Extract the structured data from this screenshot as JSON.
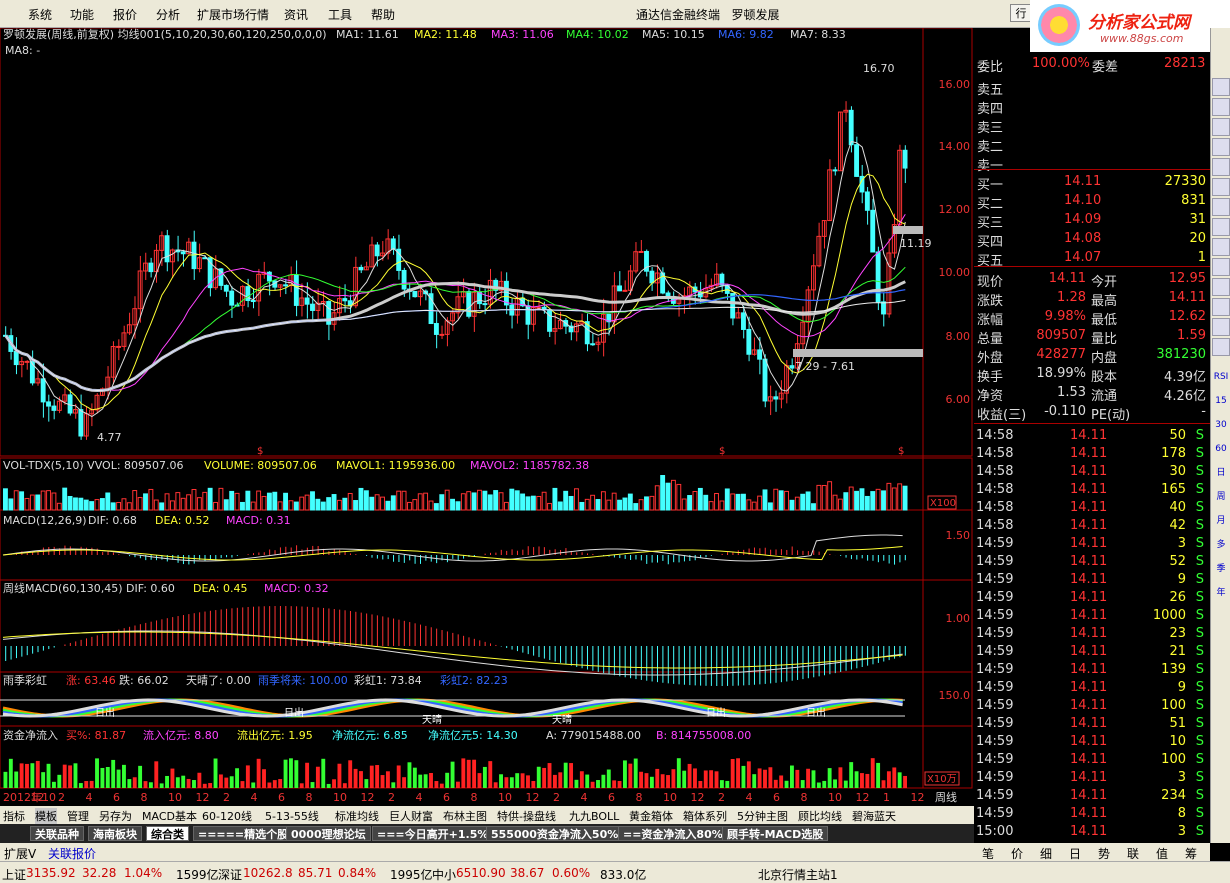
{
  "menu": {
    "items": [
      "系统",
      "功能",
      "报价",
      "分析",
      "扩展市场行情",
      "资讯",
      "工具",
      "帮助"
    ],
    "center_title": "通达信金融终端",
    "stock_title": "罗顿发展",
    "right_btn": "行"
  },
  "logo": {
    "name": "分析家公式网",
    "url": "www.88gs.com"
  },
  "main_chart": {
    "header": "罗顿发展(周线,前复权) 均线001(5,10,20,30,60,120,250,0,0,0)",
    "ma_labels": [
      "MA1: 11.61",
      "MA2: 11.48",
      "MA3: 11.06",
      "MA4: 10.02",
      "MA5: 10.15",
      "MA6: 9.82",
      "MA7: 8.33",
      "MA8: -"
    ],
    "y_ticks": [
      "16.00",
      "14.00",
      "12.00",
      "10.00",
      "8.00",
      "6.00"
    ],
    "annotations": {
      "high": "16.70",
      "low": "4.77",
      "range": "7.29 - 7.61",
      "mid": "11.19"
    }
  },
  "chart_data": {
    "type": "candlestick",
    "title": "罗顿发展(周线,前复权)",
    "y_range": [
      5.5,
      17.2
    ],
    "high": 16.7,
    "low": 4.77,
    "last": 14.11
  },
  "vol_panel": {
    "header": "VOL-TDX(5,10) VVOL: 809507.06",
    "items": [
      "VOLUME: 809507.06",
      "MAVOL1: 1195936.00",
      "MAVOL2: 1185782.38"
    ],
    "scale": "X100"
  },
  "macd_panel": {
    "header": "MACD(12,26,9)",
    "items": [
      "DIF: 0.68",
      "DEA: 0.52",
      "MACD: 0.31"
    ],
    "tick": "1.50"
  },
  "wmacd_panel": {
    "header": "周线MACD(60,130,45)",
    "items": [
      "DIF: 0.60",
      "DEA: 0.45",
      "MACD: 0.32"
    ],
    "tick": "1.00"
  },
  "rainbow_panel": {
    "header": "雨季彩虹",
    "items": [
      "涨: 63.46",
      "跌: 66.02",
      "天晴了: 0.00",
      "雨季将来: 100.00",
      "彩虹1: 73.84",
      "彩虹2: 82.23"
    ],
    "tick": "150.0",
    "labels": [
      "日出",
      "日出",
      "日出",
      "日出",
      "天晴",
      "天晴"
    ]
  },
  "flow_panel": {
    "header": "资金净流入",
    "items": [
      "买%: 81.87",
      "流入亿元: 8.80",
      "流出亿元: 1.95",
      "净流亿元: 6.85",
      "净流亿元5: 14.30",
      "A: 779015488.00",
      "B: 814755008.00"
    ],
    "scale": "X10万"
  },
  "x_axis": {
    "labels": [
      "2012年10",
      "12",
      "2",
      "4",
      "6",
      "8",
      "10",
      "12",
      "2",
      "4",
      "6",
      "8",
      "10",
      "12",
      "2",
      "4",
      "6",
      "8",
      "10",
      "12",
      "2",
      "4",
      "6",
      "8",
      "10",
      "12",
      "2",
      "4",
      "6",
      "8",
      "10",
      "12",
      "1",
      "12"
    ],
    "period": "周线"
  },
  "tabs_row1": [
    "指标",
    "模板",
    "管理",
    "另存为",
    "MACD基本",
    "60-120线",
    "5-13-55线",
    "标准均线",
    "巨人财富",
    "布林主图",
    "特供-操盘线",
    "九九BOLL",
    "黄金箱体",
    "箱体系列",
    "5分钟主图",
    "顾比均线",
    "碧海蓝天"
  ],
  "tabs_row2": [
    "关联品种",
    "海南板块",
    "综合类",
    "=====精选个股",
    "0000理想论坛",
    "===今日高开+1.5%",
    "555000资金净流入50%",
    "==资金净流入80%",
    "顾手转-MACD选股"
  ],
  "tabs_row3": [
    "扩展V",
    "关联报价"
  ],
  "quote": {
    "weibi_label": "委比",
    "weibi": "100.00%",
    "weicha_label": "委差",
    "weicha": "28213",
    "sells": [
      {
        "label": "卖五"
      },
      {
        "label": "卖四"
      },
      {
        "label": "卖三"
      },
      {
        "label": "卖二"
      },
      {
        "label": "卖一"
      }
    ],
    "buys": [
      {
        "label": "买一",
        "price": "14.11",
        "vol": "27330"
      },
      {
        "label": "买二",
        "price": "14.10",
        "vol": "831"
      },
      {
        "label": "买三",
        "price": "14.09",
        "vol": "31"
      },
      {
        "label": "买四",
        "price": "14.08",
        "vol": "20"
      },
      {
        "label": "买五",
        "price": "14.07",
        "vol": "1"
      }
    ],
    "stats": [
      {
        "l1": "现价",
        "v1": "14.11",
        "l2": "今开",
        "v2": "12.95"
      },
      {
        "l1": "涨跌",
        "v1": "1.28",
        "l2": "最高",
        "v2": "14.11"
      },
      {
        "l1": "涨幅",
        "v1": "9.98%",
        "l2": "最低",
        "v2": "12.62"
      },
      {
        "l1": "总量",
        "v1": "809507",
        "l2": "量比",
        "v2": "1.59"
      },
      {
        "l1": "外盘",
        "v1": "428277",
        "l2": "内盘",
        "v2": "381230"
      },
      {
        "l1": "换手",
        "v1": "18.99%",
        "l2": "股本",
        "v2": "4.39亿"
      },
      {
        "l1": "净资",
        "v1": "1.53",
        "l2": "流通",
        "v2": "4.26亿"
      },
      {
        "l1": "收益(三)",
        "v1": "-0.110",
        "l2": "PE(动)",
        "v2": "-"
      }
    ],
    "ticks": [
      {
        "t": "14:58",
        "p": "14.11",
        "v": "50",
        "s": "S"
      },
      {
        "t": "14:58",
        "p": "14.11",
        "v": "178",
        "s": "S"
      },
      {
        "t": "14:58",
        "p": "14.11",
        "v": "30",
        "s": "S"
      },
      {
        "t": "14:58",
        "p": "14.11",
        "v": "165",
        "s": "S"
      },
      {
        "t": "14:58",
        "p": "14.11",
        "v": "40",
        "s": "S"
      },
      {
        "t": "14:58",
        "p": "14.11",
        "v": "42",
        "s": "S"
      },
      {
        "t": "14:59",
        "p": "14.11",
        "v": "3",
        "s": "S"
      },
      {
        "t": "14:59",
        "p": "14.11",
        "v": "52",
        "s": "S"
      },
      {
        "t": "14:59",
        "p": "14.11",
        "v": "9",
        "s": "S"
      },
      {
        "t": "14:59",
        "p": "14.11",
        "v": "26",
        "s": "S"
      },
      {
        "t": "14:59",
        "p": "14.11",
        "v": "1000",
        "s": "S"
      },
      {
        "t": "14:59",
        "p": "14.11",
        "v": "23",
        "s": "S"
      },
      {
        "t": "14:59",
        "p": "14.11",
        "v": "21",
        "s": "S"
      },
      {
        "t": "14:59",
        "p": "14.11",
        "v": "139",
        "s": "S"
      },
      {
        "t": "14:59",
        "p": "14.11",
        "v": "9",
        "s": "S"
      },
      {
        "t": "14:59",
        "p": "14.11",
        "v": "100",
        "s": "S"
      },
      {
        "t": "14:59",
        "p": "14.11",
        "v": "51",
        "s": "S"
      },
      {
        "t": "14:59",
        "p": "14.11",
        "v": "10",
        "s": "S"
      },
      {
        "t": "14:59",
        "p": "14.11",
        "v": "100",
        "s": "S"
      },
      {
        "t": "14:59",
        "p": "14.11",
        "v": "3",
        "s": "S"
      },
      {
        "t": "14:59",
        "p": "14.11",
        "v": "234",
        "s": "S"
      },
      {
        "t": "14:59",
        "p": "14.11",
        "v": "8",
        "s": "S"
      },
      {
        "t": "15:00",
        "p": "14.11",
        "v": "3",
        "s": "S"
      }
    ]
  },
  "right_tabs": [
    "笔",
    "价",
    "细",
    "日",
    "势",
    "联",
    "值",
    "筹"
  ],
  "side_toolbar": [
    "RSI",
    "15",
    "30",
    "60",
    "日",
    "周",
    "月",
    "多",
    "季",
    "年"
  ],
  "status": {
    "sh_label": "上证",
    "sh": "3135.92",
    "sh_chg": "32.28",
    "sh_pct": "1.04%",
    "sh_amt": "1599亿",
    "sz_label": "深证",
    "sz": "10262.8",
    "sz_chg": "85.71",
    "sz_pct": "0.84%",
    "sz_amt": "1995亿",
    "zx_label": "中小",
    "zx": "6510.90",
    "zx_chg": "38.67",
    "zx_pct": "0.60%",
    "zx_amt": "833.0亿",
    "server": "北京行情主站1"
  }
}
